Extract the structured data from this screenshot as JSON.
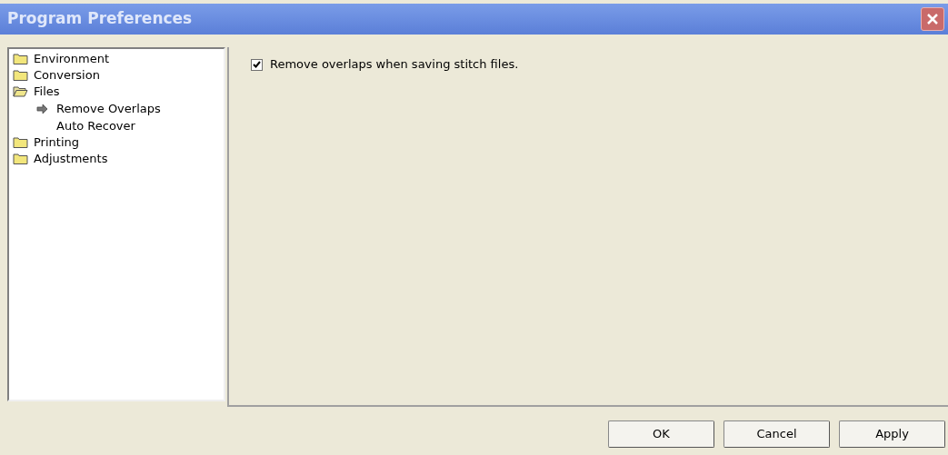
{
  "window": {
    "title": "Program Preferences"
  },
  "tree": [
    {
      "label": "Environment",
      "expanded": false
    },
    {
      "label": "Conversion",
      "expanded": false
    },
    {
      "label": "Files",
      "expanded": true,
      "children": [
        {
          "label": "Remove Overlaps",
          "selected": true
        },
        {
          "label": "Auto Recover",
          "selected": false
        }
      ]
    },
    {
      "label": "Printing",
      "expanded": false
    },
    {
      "label": "Adjustments",
      "expanded": false
    }
  ],
  "options": [
    {
      "label": "Remove overlaps when saving stitch files.",
      "checked": true
    }
  ],
  "buttons": [
    "OK",
    "Cancel",
    "Apply"
  ]
}
